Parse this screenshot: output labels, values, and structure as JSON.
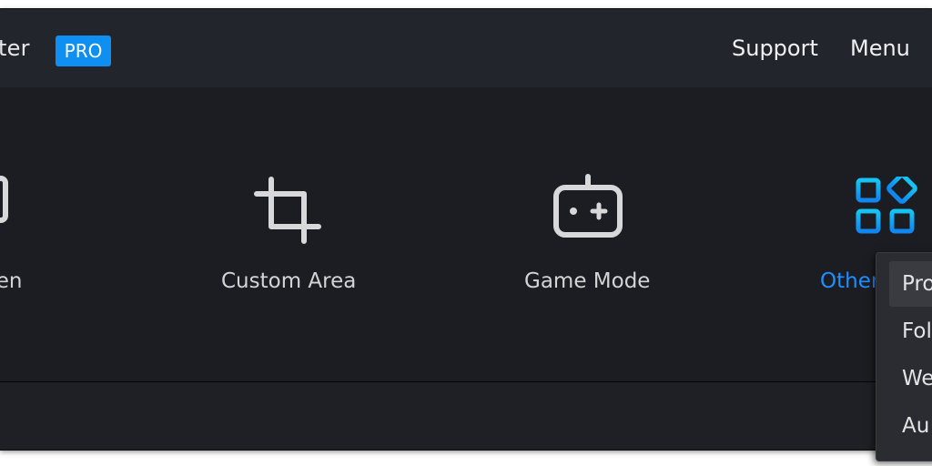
{
  "header": {
    "app_title": "ter",
    "badge": "PRO",
    "nav": [
      {
        "label": "Support"
      },
      {
        "label": "Menu"
      }
    ]
  },
  "modes": [
    {
      "label": "creen",
      "icon": "monitor-icon"
    },
    {
      "label": "Custom Area",
      "icon": "crop-icon"
    },
    {
      "label": "Game Mode",
      "icon": "gamepad-icon"
    },
    {
      "label": "Other",
      "icon": "apps-grid-icon",
      "active": true
    }
  ],
  "dropdown": {
    "items": [
      {
        "label": "Pro"
      },
      {
        "label": "Fol"
      },
      {
        "label": "We"
      },
      {
        "label": "Au"
      }
    ]
  },
  "colors": {
    "accent": "#0f8ff2",
    "active_label": "#1e8fff",
    "active_icon": "#12b4f5",
    "background": "#1c1d22",
    "header": "#23252c"
  }
}
